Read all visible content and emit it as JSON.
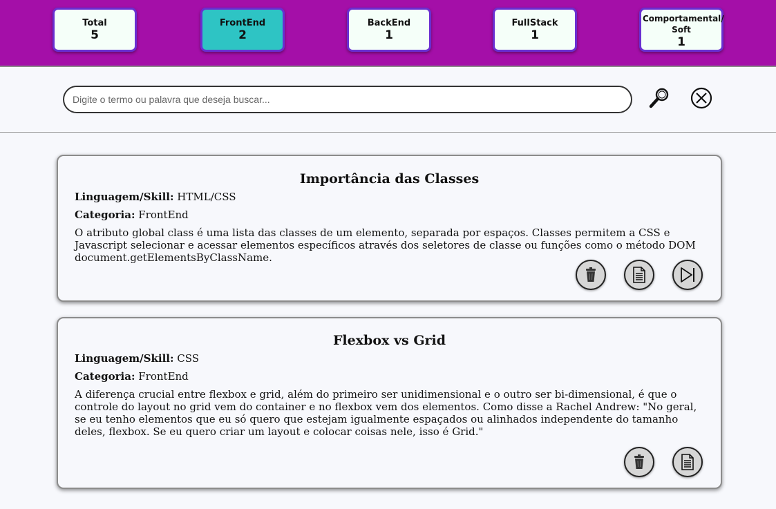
{
  "stats": [
    {
      "label": "Total",
      "count": "5",
      "active": false
    },
    {
      "label": "FrontEnd",
      "count": "2",
      "active": true
    },
    {
      "label": "BackEnd",
      "count": "1",
      "active": false
    },
    {
      "label": "FullStack",
      "count": "1",
      "active": false
    },
    {
      "label": "Comportamental/ Soft",
      "count": "1",
      "active": false
    }
  ],
  "search": {
    "placeholder": "Digite o termo ou palavra que deseja buscar...",
    "value": "",
    "search_icon": "magnifier-icon",
    "clear_icon": "circle-x-icon"
  },
  "colors": {
    "header_bg": "#a40fa8",
    "active_stat": "#2ec4c4",
    "stat_border": "#6a2fd1"
  },
  "cards": [
    {
      "title": "Importância das Classes",
      "language_label": "Linguagem/Skill:",
      "language": "HTML/CSS",
      "category_label": "Categoria:",
      "category": "FrontEnd",
      "description": "O atributo global class é uma lista das classes de um elemento, separada por espaços. Classes permitem a CSS e Javascript selecionar e acessar elementos específicos através dos seletores de classe ou funções como o método DOM document.getElementsByClassName.",
      "actions": [
        "trash-icon",
        "document-icon",
        "skip-forward-icon"
      ]
    },
    {
      "title": "Flexbox vs Grid",
      "language_label": "Linguagem/Skill:",
      "language": "CSS",
      "category_label": "Categoria:",
      "category": "FrontEnd",
      "description": "A diferença crucial entre flexbox e grid, além do primeiro ser unidimensional e o outro ser bi-dimensional, é que o controle do layout no grid vem do container e no flexbox vem dos elementos. Como disse a Rachel Andrew: \"No geral, se eu tenho elementos que eu só quero que estejam igualmente espaçados ou alinhados independente do tamanho deles, flexbox. Se eu quero criar um layout e colocar coisas nele, isso é Grid.\"",
      "actions": [
        "trash-icon",
        "document-icon"
      ]
    }
  ]
}
